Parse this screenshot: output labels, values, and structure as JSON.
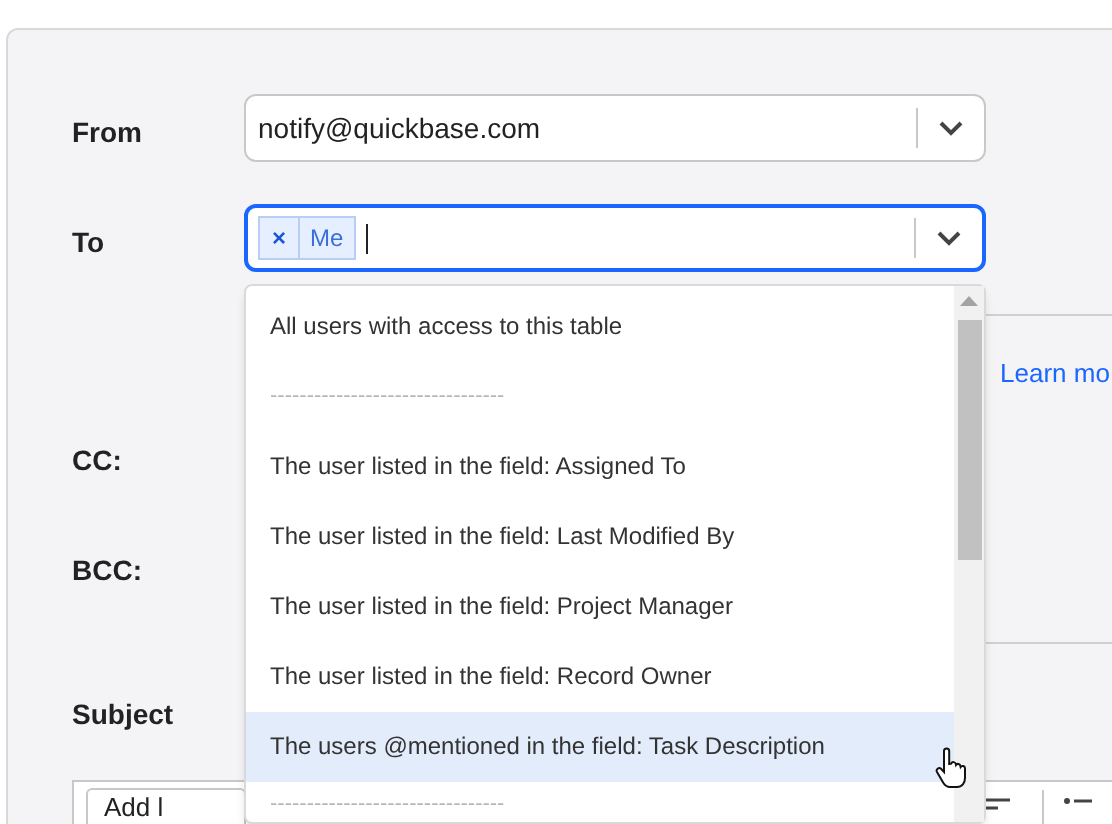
{
  "form": {
    "from": {
      "label": "From",
      "value": "notify@quickbase.com"
    },
    "to": {
      "label": "To",
      "chips": [
        {
          "remove": "×",
          "text": "Me"
        }
      ],
      "focused": true
    },
    "cc": {
      "label": "CC:"
    },
    "bcc": {
      "label": "BCC:"
    },
    "subject": {
      "label": "Subject"
    },
    "learn_more": "Learn mo",
    "editor_toolbar": {
      "format_select": "Add l"
    }
  },
  "dropdown": {
    "items": [
      {
        "kind": "option",
        "text": "All users with access to this table",
        "selected": false
      },
      {
        "kind": "separator",
        "text": "--------------------------------",
        "selected": false
      },
      {
        "kind": "option",
        "text": "The user listed in the field: Assigned To",
        "selected": false
      },
      {
        "kind": "option",
        "text": "The user listed in the field: Last Modified By",
        "selected": false
      },
      {
        "kind": "option",
        "text": "The user listed in the field: Project Manager",
        "selected": false
      },
      {
        "kind": "option",
        "text": "The user listed in the field: Record Owner",
        "selected": false
      },
      {
        "kind": "option",
        "text": "The users @mentioned in the field: Task Description",
        "selected": true
      },
      {
        "kind": "separator",
        "text": "--------------------------------",
        "selected": false
      }
    ]
  }
}
